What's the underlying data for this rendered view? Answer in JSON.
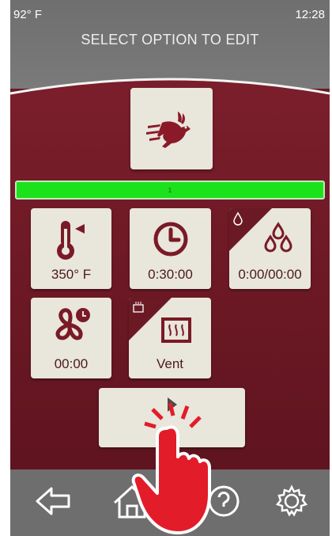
{
  "status": {
    "temperature": "92° F",
    "time": "12:28"
  },
  "header": {
    "title": "SELECT OPTION TO EDIT"
  },
  "progress": {
    "label": "1",
    "value": 1.0,
    "color": "#1be21b"
  },
  "tiles": {
    "speed": {
      "icon": "running-rabbit-icon"
    },
    "temperature": {
      "label": "350° F",
      "icon": "thermometer-icon"
    },
    "time": {
      "label": "0:30:00",
      "icon": "clock-icon"
    },
    "humidity": {
      "label": "0:00/00:00",
      "icon": "water-drops-icon"
    },
    "fan": {
      "label": "00:00",
      "icon": "fan-timer-icon"
    },
    "vent": {
      "label": "Vent",
      "icon": "vent-icon"
    }
  },
  "start": {
    "icon": "play-icon"
  },
  "nav": {
    "back": {
      "icon": "back-arrow-icon"
    },
    "home": {
      "icon": "home-icon"
    },
    "help": {
      "icon": "help-icon"
    },
    "settings": {
      "icon": "gear-icon"
    }
  },
  "overlay": {
    "icon": "tap-hand-icon"
  },
  "colors": {
    "maroon": "#6b1a25",
    "tile": "#e9e6dc",
    "header": "#707070",
    "icon": "#7a1a26",
    "progress": "#1be21b"
  }
}
